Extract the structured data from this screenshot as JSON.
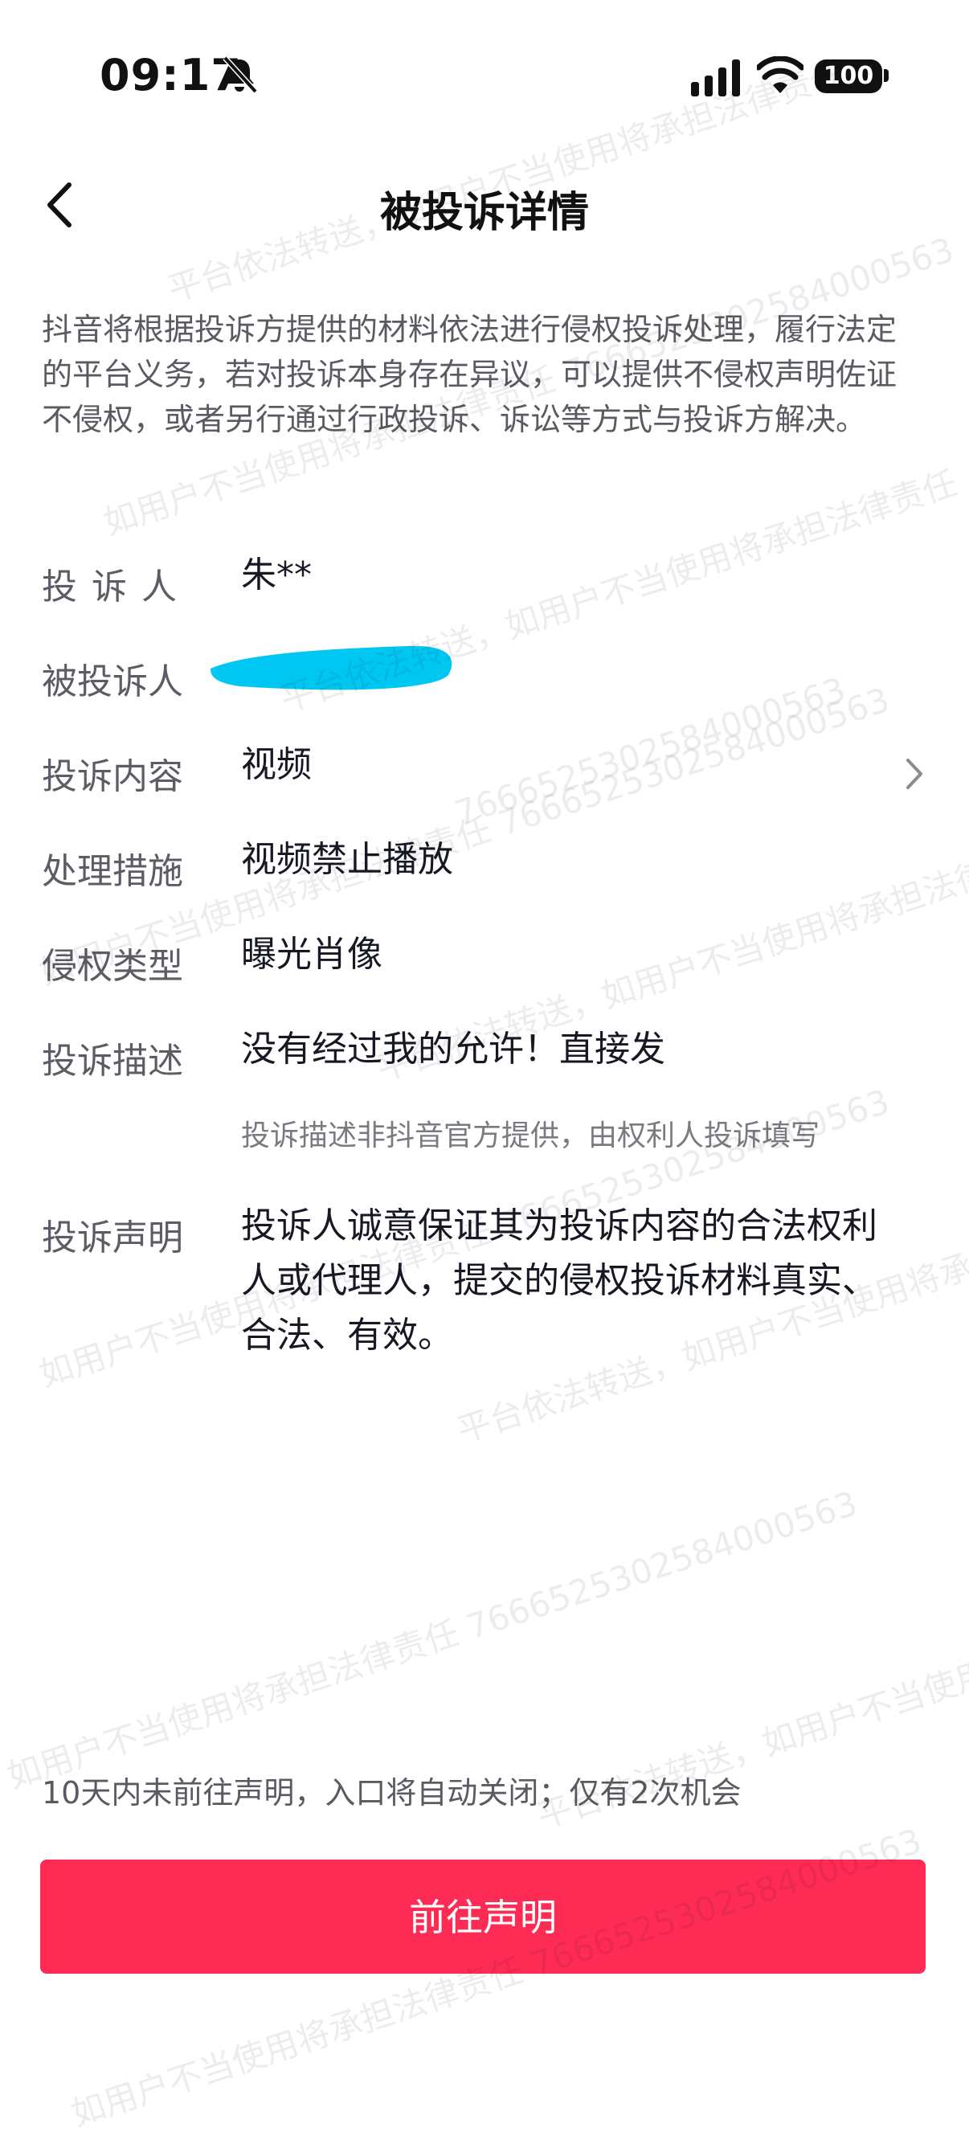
{
  "status_bar": {
    "time": "09:17",
    "battery": "100",
    "icons": [
      "bell-mute-icon",
      "signal-icon",
      "wifi-icon",
      "battery-icon"
    ]
  },
  "nav": {
    "title": "被投诉详情",
    "back_icon": "chevron-left-icon"
  },
  "intro": "抖音将根据投诉方提供的材料依法进行侵权投诉处理，履行法定的平台义务，若对投诉本身存在异议，可以提供不侵权声明佐证不侵权，或者另行通过行政投诉、诉讼等方式与投诉方解决。",
  "details": {
    "complainant": {
      "label": "投诉人",
      "value": "朱**"
    },
    "respondent": {
      "label": "被投诉人",
      "value": ""
    },
    "content": {
      "label": "投诉内容",
      "value": "视频"
    },
    "measure": {
      "label": "处理措施",
      "value": "视频禁止播放"
    },
    "type": {
      "label": "侵权类型",
      "value": "曝光肖像"
    },
    "description": {
      "label": "投诉描述",
      "value": "没有经过我的允许！直接发",
      "note": "投诉描述非抖音官方提供，由权利人投诉填写"
    },
    "statement": {
      "label": "投诉声明",
      "value": "投诉人诚意保证其为投诉内容的合法权利人或代理人，提交的侵权投诉材料真实、合法、有效。"
    }
  },
  "footer": {
    "note": "10天内未前往声明，入口将自动关闭；仅有2次机会",
    "button": "前往声明"
  },
  "watermark": {
    "a": "平台依法转送，如用户不当使用将承担法律责任",
    "b": "7666525302584000563",
    "c": "如用户不当使用将承担法律责任 7666525302584000563"
  },
  "colors": {
    "accent": "#fe2c55",
    "redaction": "#00c6f2"
  }
}
